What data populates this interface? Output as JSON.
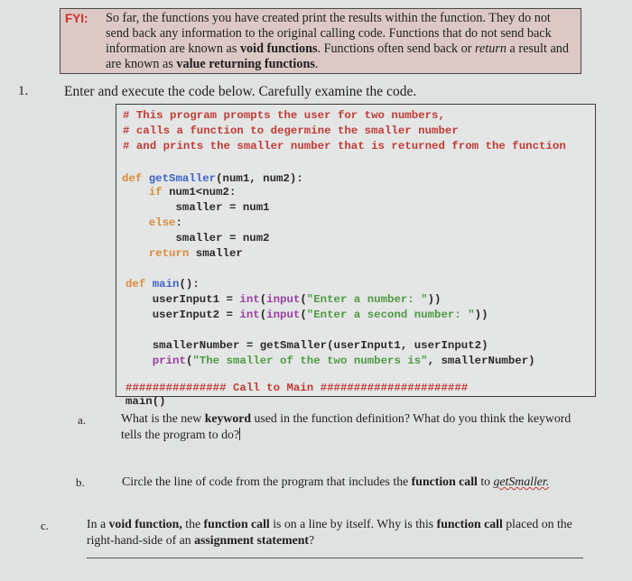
{
  "fyi": {
    "label": "FYI:",
    "text_parts": [
      {
        "t": "So far, the functions you have created print the results within the function. They do not send back any information to the original calling code. Functions that do not send back information are known as ",
        "style": "plain"
      },
      {
        "t": "void functions",
        "style": "bold"
      },
      {
        "t": ". Functions often send back or ",
        "style": "plain"
      },
      {
        "t": "return",
        "style": "italic"
      },
      {
        "t": " a result and are known as ",
        "style": "plain"
      },
      {
        "t": "value returning functions",
        "style": "bold"
      },
      {
        "t": ".",
        "style": "plain"
      }
    ]
  },
  "question": {
    "number": "1.",
    "text": "Enter and execute the code below. Carefully examine the code."
  },
  "code": {
    "lines": [
      [
        {
          "t": "# This program prompts the user for two numbers,",
          "c": "comment"
        }
      ],
      [
        {
          "t": "# calls a function to degermine the smaller number",
          "c": "comment"
        }
      ],
      [
        {
          "t": "# and prints the smaller number that is returned from the function",
          "c": "comment"
        }
      ],
      [],
      [
        {
          "t": "def ",
          "c": "kw"
        },
        {
          "t": "getSmaller",
          "c": "fn"
        },
        {
          "t": "(num1, num2):",
          "c": "plain"
        }
      ],
      [
        {
          "t": "    if ",
          "c": "kw"
        },
        {
          "t": "num1<num2:",
          "c": "plain"
        }
      ],
      [
        {
          "t": "        smaller = num1",
          "c": "plain"
        }
      ],
      [
        {
          "t": "    else",
          "c": "kw"
        },
        {
          "t": ":",
          "c": "plain"
        }
      ],
      [
        {
          "t": "        smaller = num2",
          "c": "plain"
        }
      ],
      [
        {
          "t": "    return ",
          "c": "kw"
        },
        {
          "t": "smaller",
          "c": "plain"
        }
      ],
      [],
      [
        {
          "t": "def ",
          "c": "kw"
        },
        {
          "t": "main",
          "c": "fn"
        },
        {
          "t": "():",
          "c": "plain"
        }
      ],
      [
        {
          "t": "    userInput1 = ",
          "c": "plain"
        },
        {
          "t": "int",
          "c": "builtin"
        },
        {
          "t": "(",
          "c": "plain"
        },
        {
          "t": "input",
          "c": "builtin"
        },
        {
          "t": "(",
          "c": "plain"
        },
        {
          "t": "\"Enter a number: \"",
          "c": "str"
        },
        {
          "t": "))",
          "c": "plain"
        }
      ],
      [
        {
          "t": "    userInput2 = ",
          "c": "plain"
        },
        {
          "t": "int",
          "c": "builtin"
        },
        {
          "t": "(",
          "c": "plain"
        },
        {
          "t": "input",
          "c": "builtin"
        },
        {
          "t": "(",
          "c": "plain"
        },
        {
          "t": "\"Enter a second number: \"",
          "c": "str"
        },
        {
          "t": "))",
          "c": "plain"
        }
      ],
      [],
      [
        {
          "t": "    smallerNumber = getSmaller(userInput1, userInput2)",
          "c": "plain"
        }
      ],
      [
        {
          "t": "    ",
          "c": "plain"
        },
        {
          "t": "print",
          "c": "builtin"
        },
        {
          "t": "(",
          "c": "plain"
        },
        {
          "t": "\"The smaller of the two numbers is\"",
          "c": "str"
        },
        {
          "t": ", smallerNumber)",
          "c": "plain"
        }
      ],
      [],
      [
        {
          "t": "############### Call to Main ######################",
          "c": "comment"
        }
      ],
      [
        {
          "t": "main()",
          "c": "plain"
        }
      ]
    ]
  },
  "subquestions": [
    {
      "label": "a.",
      "parts": [
        {
          "t": "What is the new ",
          "style": "plain"
        },
        {
          "t": "keyword",
          "style": "bold"
        },
        {
          "t": " used in the function definition? What do you think the keyword tells the program to do?",
          "style": "plain"
        }
      ],
      "has_cursor": true
    },
    {
      "label": "b.",
      "parts": [
        {
          "t": "Circle the line of code from the program that includes the ",
          "style": "plain"
        },
        {
          "t": "function call",
          "style": "bold"
        },
        {
          "t": " to ",
          "style": "plain"
        },
        {
          "t": "getSmaller.",
          "style": "squiggle"
        }
      ]
    },
    {
      "label": "c.",
      "parts": [
        {
          "t": "In a ",
          "style": "plain"
        },
        {
          "t": "void function,",
          "style": "bold"
        },
        {
          "t": " the ",
          "style": "plain"
        },
        {
          "t": "function call",
          "style": "bold"
        },
        {
          "t": " is on a line by itself.  Why is this ",
          "style": "plain"
        },
        {
          "t": "function call",
          "style": "bold"
        },
        {
          "t": " placed on the right-hand-side of an ",
          "style": "plain"
        },
        {
          "t": "assignment statement",
          "style": "bold"
        },
        {
          "t": "?",
          "style": "plain"
        }
      ]
    }
  ]
}
